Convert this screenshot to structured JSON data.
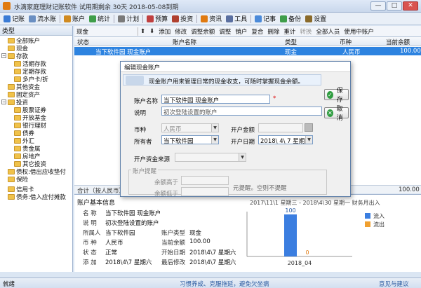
{
  "window": {
    "title": "水滴家庭理财记账软件  试用期剩余 30天  2018-05-08到期",
    "min": "—",
    "max": "□",
    "close": "✕"
  },
  "menu": [
    {
      "label": "记账",
      "icon": "pen-icon",
      "color": "#3a7bd5"
    },
    {
      "label": "流水账",
      "icon": "list-icon",
      "color": "#6a8fc2"
    },
    {
      "label": "账户",
      "icon": "account-icon",
      "color": "#d08a20"
    },
    {
      "label": "统计",
      "icon": "chart-icon",
      "color": "#3f9e4a"
    },
    {
      "label": "计划",
      "icon": "plan-icon",
      "color": "#7a7a7a"
    },
    {
      "label": "预算",
      "icon": "budget-icon",
      "color": "#c04040"
    },
    {
      "label": "投资",
      "icon": "invest-icon",
      "color": "#b0402f"
    },
    {
      "label": "资讯",
      "icon": "news-icon",
      "color": "#e07a10"
    },
    {
      "label": "工具",
      "icon": "tool-icon",
      "color": "#5a6fa0"
    },
    {
      "label": "记事",
      "icon": "note-icon",
      "color": "#4b8ad9"
    },
    {
      "label": "备份",
      "icon": "backup-icon",
      "color": "#3f9e4a"
    },
    {
      "label": "设置",
      "icon": "settings-icon",
      "color": "#8a6a2a"
    }
  ],
  "left": {
    "header": "类型",
    "items": [
      "全部账户",
      "现金",
      "存款",
      "活期存款",
      "定期存款",
      "多户卡/折",
      "其他资金",
      "固定资产",
      "投资",
      "股票证券",
      "开放基金",
      "银行理财",
      "债券",
      "外汇",
      "贵金属",
      "房地产",
      "其它投资",
      "债权:借出应收垫付",
      "保险",
      "信用卡",
      "债务:借入应付摊款"
    ]
  },
  "toolbar": {
    "account": "现金",
    "items": [
      "添加",
      "修改",
      "调整余额",
      "调整",
      "销户",
      "复合",
      "删除",
      "重计",
      "转换",
      "全部人员",
      "使用中账户"
    ]
  },
  "grid": {
    "headers": [
      "状态",
      "账户名称",
      "类型",
      "币种",
      "当前余额"
    ],
    "rows": [
      {
        "status": "",
        "name": "当下软件园 现金账户",
        "type": "现金",
        "currency": "人民币",
        "balance": "100.00"
      }
    ]
  },
  "summary": {
    "label": "合计（按人民币）",
    "value": "100.00"
  },
  "info": {
    "title": "账户基本信息",
    "fields": [
      [
        "名  称",
        "当下软件园 现金账户"
      ],
      [
        "说  明",
        "初次登陆设置的账户"
      ],
      [
        "所属人",
        "当下软件园"
      ],
      [
        "币  种",
        "人民币"
      ],
      [
        "状  态",
        "正常"
      ],
      [
        "添  加",
        "2018\\4\\7 星期六"
      ]
    ],
    "fields2": [
      [
        "账户类型",
        "现金"
      ],
      [
        "当前余额",
        "100.00"
      ],
      [
        "开始日期",
        "2018\\4\\7  星期六"
      ],
      [
        "最后修改",
        "2018\\4\\7  星期六"
      ]
    ]
  },
  "chart_data": {
    "type": "bar",
    "title": "2017\\11\\1 星期三 - 2018\\4\\30 星期一 财务月出入",
    "categories": [
      "2018_04"
    ],
    "series": [
      {
        "name": "流入",
        "values": [
          100
        ],
        "color": "#3b7ee0"
      },
      {
        "name": "流出",
        "values": [
          0
        ],
        "color": "#f0a030"
      }
    ],
    "ylim": [
      0,
      100
    ]
  },
  "dialog": {
    "title": "编辑现金账户",
    "banner": "现金账户用来管理日常的现金收支，可随时掌握现金余额。",
    "name_label": "账户名称",
    "name_value": "当下软件园 现金账户",
    "desc_label": "说明",
    "desc_placeholder": "初次登陆设置的账户",
    "currency_label": "币种",
    "currency_value": "人民币",
    "owner_label": "所有者",
    "owner_value": "当下软件园",
    "opening_label": "开户金额",
    "date_label": "开户日期",
    "date_value": "2018\\ 4\\ 7 星期六",
    "source_label": "开户资金来源",
    "remind_label": "账户提醒",
    "above_label": "余额高于",
    "below_label": "余额低于",
    "remind_text": "元提醒。空则不提醒",
    "save": "保 存",
    "cancel": "取 消",
    "required": "*"
  },
  "status": {
    "left": "就绪",
    "center": "习惯养成、克服拖延，避免欠坐病",
    "right": "意见与建议"
  }
}
